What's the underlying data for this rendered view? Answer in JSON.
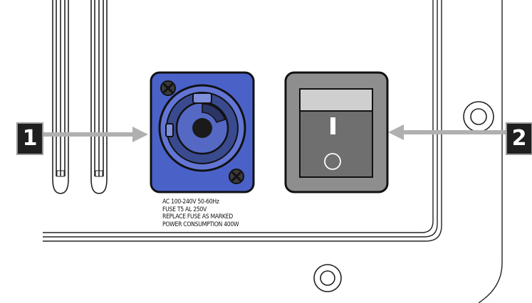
{
  "callouts": [
    {
      "label": "1",
      "target": "power-input-connector"
    },
    {
      "label": "2",
      "target": "power-switch"
    }
  ],
  "spec_lines": [
    "AC 100-240V  50-60Hz",
    "FUSE T5 AL 250V",
    "REPLACE FUSE AS MARKED",
    "POWER CONSUMPTION 400W"
  ],
  "colors": {
    "connector_plate": "#4a62c8",
    "connector_body": "#3a4a8e",
    "switch_frame": "#8e8e8e",
    "switch_rocker": "#6f6f6f",
    "switch_rocker_top": "#cfcfcf",
    "arrow": "#b0b0b0",
    "callout_bg": "#1f1f1f"
  },
  "switch": {
    "on_symbol": "I",
    "off_symbol": "O"
  }
}
